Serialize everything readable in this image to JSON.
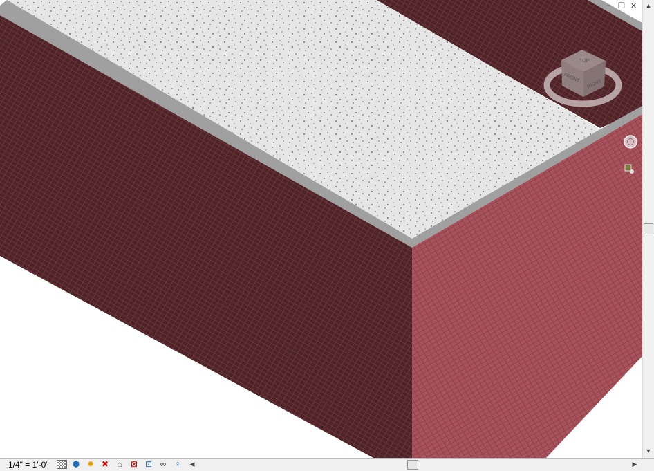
{
  "view": {
    "type": "3D view",
    "roof_color": "#e6e6e6",
    "wall_dark_color": "#4f2428",
    "wall_light_color": "#a8525c",
    "parapet_color": "#a0a0a0"
  },
  "viewcube": {
    "top": "TOP",
    "front": "FRONT",
    "right": "RIGHT"
  },
  "window_controls": {
    "minimize": "–",
    "restore": "❐",
    "close": "✕"
  },
  "status_bar": {
    "scale": "1/4\" = 1'-0\"",
    "icons": [
      "detail-level-icon",
      "visual-style-icon",
      "sun-path-icon",
      "shadows-icon",
      "crop-view-icon",
      "show-crop-region-icon",
      "unlock-3d-view-icon",
      "temporary-hide-icon",
      "reveal-hidden-icon"
    ]
  }
}
